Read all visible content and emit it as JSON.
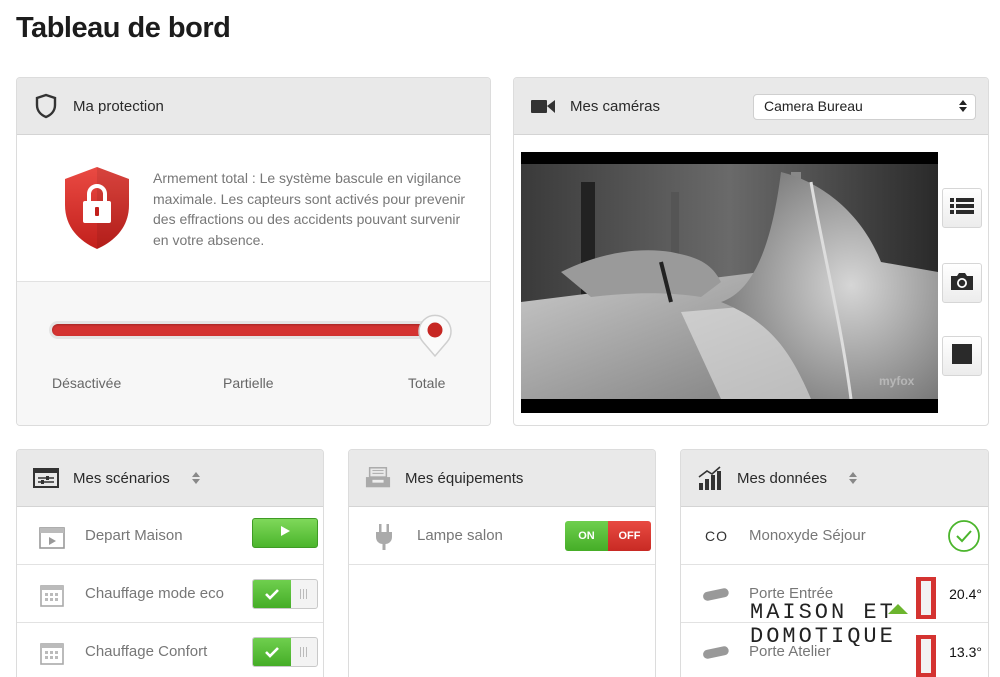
{
  "page": {
    "title": "Tableau de bord"
  },
  "protection": {
    "title": "Ma protection",
    "description": "Armement total : Le système bascule en vigilance maximale. Les capteurs sont activés pour prevenir des effractions ou des accidents pouvant survenir en votre absence.",
    "levels": [
      "Désactivée",
      "Partielle",
      "Totale"
    ],
    "selected_level": "Totale",
    "accent_color": "#d43331"
  },
  "cameras": {
    "title": "Mes caméras",
    "selected_camera": "Camera Bureau",
    "watermark": "myfox"
  },
  "scenarios": {
    "title": "Mes scénarios",
    "items": [
      {
        "label": "Depart Maison",
        "control": "play",
        "icon": "movie-icon"
      },
      {
        "label": "Chauffage mode eco",
        "control": "toggle",
        "enabled": true,
        "icon": "calendar-icon"
      },
      {
        "label": "Chauffage Confort",
        "control": "toggle",
        "enabled": true,
        "icon": "calendar-icon"
      }
    ]
  },
  "equipements": {
    "title": "Mes équipements",
    "items": [
      {
        "label": "Lampe salon",
        "on_label": "ON",
        "off_label": "OFF",
        "icon": "plug-icon"
      }
    ]
  },
  "donnees": {
    "title": "Mes données",
    "items": [
      {
        "label": "Monoxyde Séjour",
        "icon_text": "CO",
        "status": "ok"
      },
      {
        "label": "Porte Entrée",
        "value": "20.4°",
        "icon": "sensor-icon"
      },
      {
        "label": "Porte Atelier",
        "value": "13.3°",
        "icon": "sensor-icon"
      }
    ]
  },
  "overlay": {
    "line1": "MAISON ET",
    "line2": "DOMOTIQUE"
  },
  "colors": {
    "green": "#4bb52c",
    "red": "#c82a24",
    "header_bg": "#e9e9e9"
  }
}
